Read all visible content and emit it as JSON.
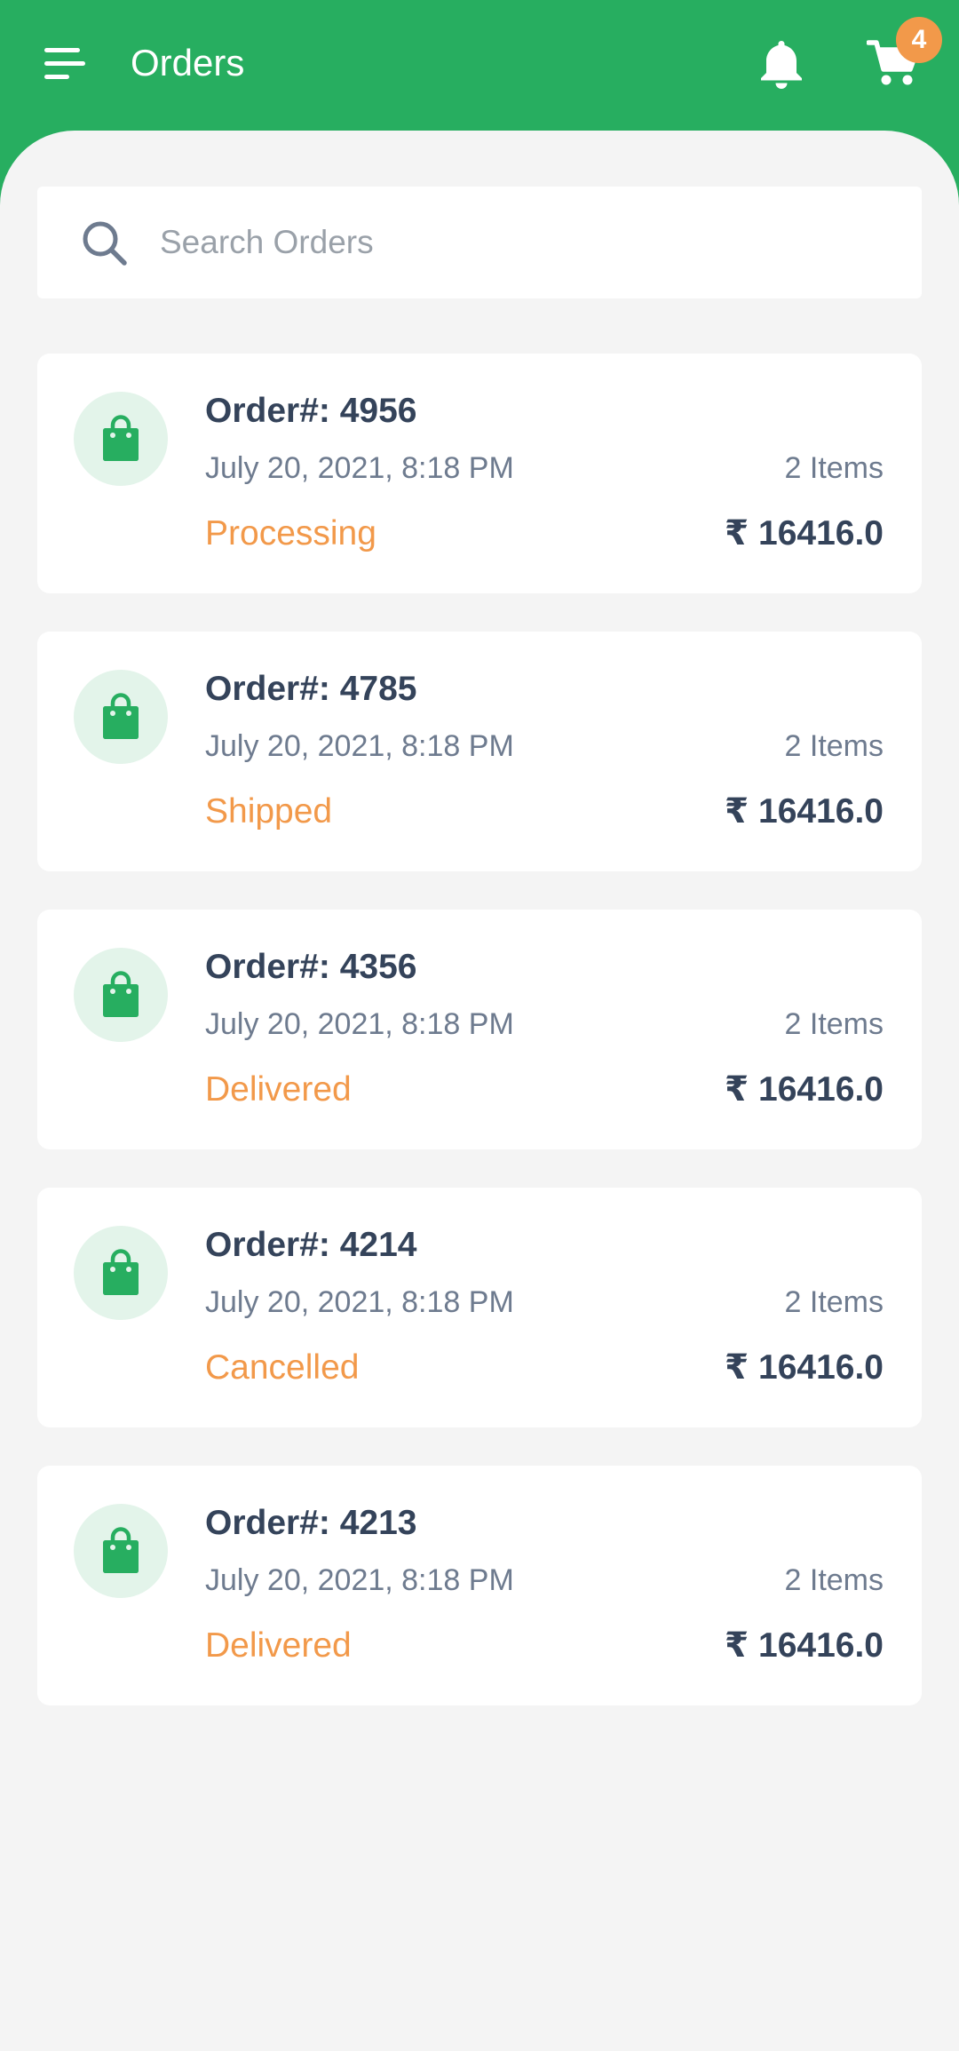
{
  "header": {
    "title": "Orders",
    "cart_count": "4",
    "menu_icon": "menu-icon",
    "bell_icon": "bell-icon",
    "cart_icon": "cart-icon"
  },
  "search": {
    "placeholder": "Search Orders",
    "value": ""
  },
  "colors": {
    "brand": "#27ae60",
    "accent": "#f2994a",
    "background": "#f4f4f4",
    "text_dark": "#34435a",
    "text_muted": "#6e7b8f"
  },
  "orders": [
    {
      "id": "Order#: 4956",
      "date": "July 20, 2021, 8:18 PM",
      "items": "2 Items",
      "status": "Processing",
      "price": "₹ 16416.0",
      "icon": "shopping-bag-icon"
    },
    {
      "id": "Order#: 4785",
      "date": "July 20, 2021, 8:18 PM",
      "items": "2 Items",
      "status": "Shipped",
      "price": "₹ 16416.0",
      "icon": "shopping-bag-icon"
    },
    {
      "id": "Order#: 4356",
      "date": "July 20, 2021, 8:18 PM",
      "items": "2 Items",
      "status": "Delivered",
      "price": "₹ 16416.0",
      "icon": "shopping-bag-icon"
    },
    {
      "id": "Order#: 4214",
      "date": "July 20, 2021, 8:18 PM",
      "items": "2 Items",
      "status": "Cancelled",
      "price": "₹ 16416.0",
      "icon": "shopping-bag-icon"
    },
    {
      "id": "Order#: 4213",
      "date": "July 20, 2021, 8:18 PM",
      "items": "2 Items",
      "status": "Delivered",
      "price": "₹ 16416.0",
      "icon": "shopping-bag-icon"
    }
  ]
}
